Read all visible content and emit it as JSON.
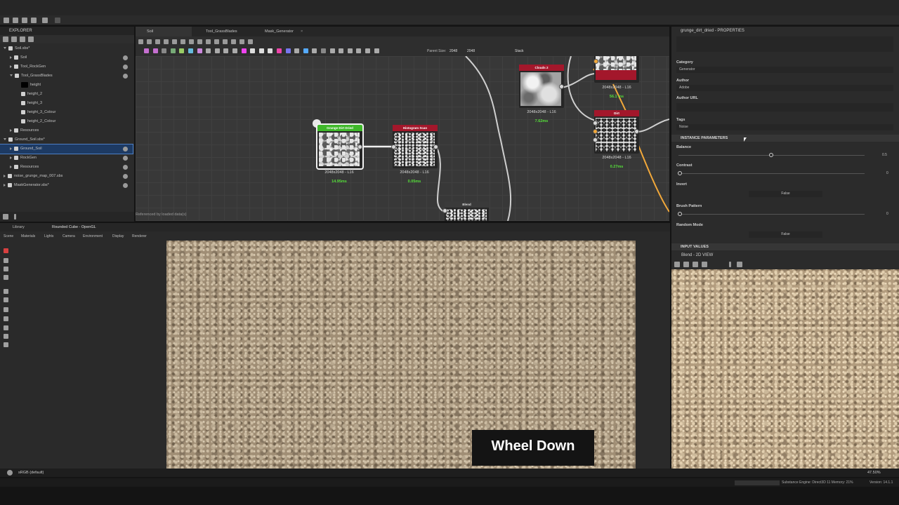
{
  "explorer": {
    "title": "EXPLORER",
    "items": [
      {
        "label": "Soil.sbs*",
        "level": 0
      },
      {
        "label": "Soil",
        "level": 1
      },
      {
        "label": "Tool_RockGen",
        "level": 1
      },
      {
        "label": "Tool_GrassBlades",
        "level": 1
      },
      {
        "label": "height",
        "level": 2
      },
      {
        "label": "height_2",
        "level": 2
      },
      {
        "label": "height_3",
        "level": 2
      },
      {
        "label": "height_3_Colour",
        "level": 2
      },
      {
        "label": "height_2_Colour",
        "level": 2
      },
      {
        "label": "Resources",
        "level": 1
      },
      {
        "label": "Ground_Soil.sbs*",
        "level": 0
      },
      {
        "label": "Ground_Soil",
        "level": 1
      },
      {
        "label": "RockGen",
        "level": 1
      },
      {
        "label": "Resources",
        "level": 1
      },
      {
        "label": "noise_grunge_map_007.sbs",
        "level": 0
      },
      {
        "label": "MaskGenerator.sbs*",
        "level": 0
      }
    ]
  },
  "graph": {
    "tabs": [
      "Soil",
      "Tool_GrassBlades",
      "Mask_Generator"
    ],
    "parent_size_label": "Parent Size:",
    "parent_size_value": "2048",
    "size_value": "2048",
    "stack_label": "Stack",
    "footer": "Referenced by loaded data(s)",
    "nodes": {
      "grunge": {
        "title": "Grunge Dirt Dried",
        "res": "2048x2048 - L16",
        "time": "14.95ms"
      },
      "histogram": {
        "title": "Histogram Scan",
        "res": "2048x2048 - L16",
        "time": "0.05ms"
      },
      "clouds": {
        "title": "Clouds 2",
        "res": "2048x2048 - L16",
        "time": "7.62ms"
      },
      "top": {
        "res": "2048x2048 - L16",
        "time": "56.1 ms"
      },
      "dirt": {
        "title": "Dirt",
        "res": "2048x2048 - L16",
        "time": "0.27ms"
      },
      "blend": {
        "title": "Blend"
      }
    }
  },
  "properties": {
    "title": "grunge_dirt_dried - PROPERTIES",
    "category_label": "Category",
    "category_value": "Generator",
    "author_label": "Author",
    "author_value": "Adobe",
    "author_url_label": "Author URL",
    "author_url_value": "",
    "tags_label": "Tags",
    "tags_value": "Noise",
    "instance_parameters": "INSTANCE PARAMETERS",
    "balance_label": "Balance",
    "balance_value": "0.5",
    "contrast_label": "Contrast",
    "contrast_value": "0",
    "invert_label": "Invert",
    "invert_value": "False",
    "brush_pattern_label": "Brush Pattern",
    "brush_pattern_value": "0",
    "random_mode_label": "Random Mode",
    "random_mode_value": "False",
    "input_values": "INPUT VALUES"
  },
  "view3d": {
    "tabs": [
      "Library",
      "Rounded Cube - OpenGL"
    ],
    "menu": [
      "Scene",
      "Materials",
      "Lights",
      "Camera",
      "Environment",
      "Display",
      "Renderer"
    ],
    "colorspace": "sRGB (default)"
  },
  "view2d": {
    "title": "Blend - 2D VIEW",
    "zoom": "47.50%"
  },
  "status": {
    "engine": "Substance Engine: Direct3D 11  Memory: 21%",
    "version": "Version: 14.1.1"
  },
  "caption": "Wheel Down"
}
